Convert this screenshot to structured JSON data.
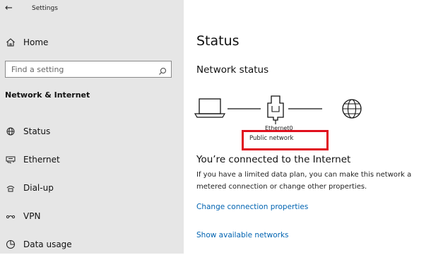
{
  "window": {
    "title": "Settings",
    "back_glyph": "←"
  },
  "sidebar": {
    "home_label": "Home",
    "search_placeholder": "Find a setting",
    "section_title": "Network & Internet",
    "items": [
      {
        "label": "Status",
        "icon": "status-icon"
      },
      {
        "label": "Ethernet",
        "icon": "ethernet-icon"
      },
      {
        "label": "Dial-up",
        "icon": "dialup-icon"
      },
      {
        "label": "VPN",
        "icon": "vpn-icon"
      },
      {
        "label": "Data usage",
        "icon": "data-usage-icon"
      }
    ]
  },
  "main": {
    "title": "Status",
    "network_status_heading": "Network status",
    "adapter_name": "Ethernet0",
    "network_type": "Public network",
    "connected_text": "You’re connected to the Internet",
    "description": "If you have a limited data plan, you can make this network a metered connection or change other properties.",
    "links": {
      "change_properties": "Change connection properties",
      "show_networks": "Show available networks"
    }
  },
  "colors": {
    "sidebar_bg": "#e6e6e6",
    "link": "#0063b1",
    "highlight": "#e0101e"
  }
}
